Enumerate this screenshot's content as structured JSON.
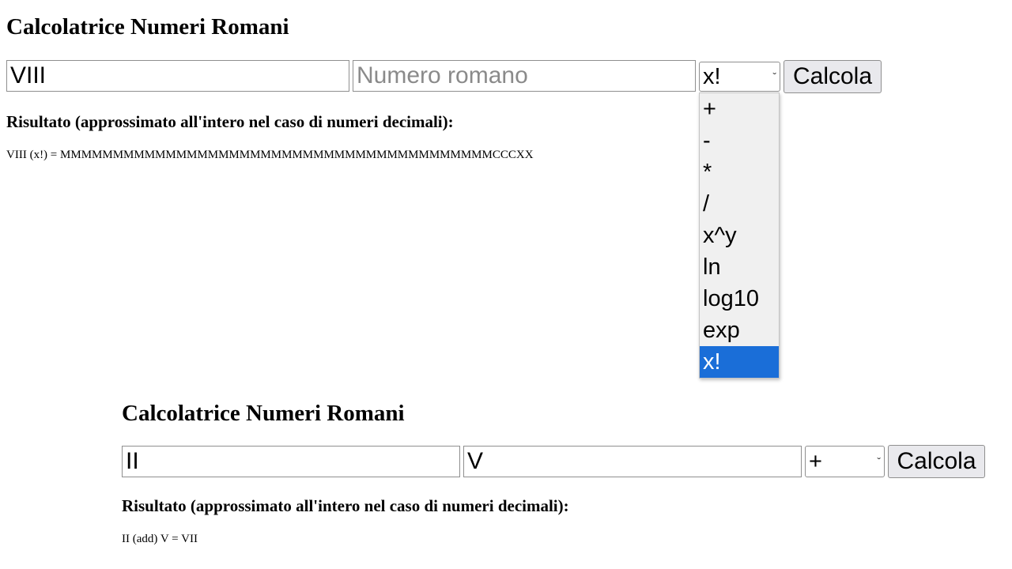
{
  "calculators": [
    {
      "title": "Calcolatrice Numeri Romani",
      "input_a": {
        "value": "VIII",
        "placeholder": "Numero romano"
      },
      "input_b": {
        "value": "",
        "placeholder": "Numero romano"
      },
      "operation": {
        "selected": "x!"
      },
      "button_label": "Calcola",
      "result_heading": "Risultato (approssimato all'intero nel caso di numeri decimali):",
      "result_text": "VIII (x!) = MMMMMMMMMMMMMMMMMMMMMMMMMMMMMMMMMMMMMMMMMCCCXX"
    },
    {
      "title": "Calcolatrice Numeri Romani",
      "input_a": {
        "value": "II",
        "placeholder": "Numero romano"
      },
      "input_b": {
        "value": "V",
        "placeholder": "Numero romano"
      },
      "operation": {
        "selected": "+"
      },
      "button_label": "Calcola",
      "result_heading": "Risultato (approssimato all'intero nel caso di numeri decimali):",
      "result_text": "II (add) V = VII"
    }
  ],
  "dropdown": {
    "options": [
      "+",
      "-",
      "*",
      "/",
      "x^y",
      "ln",
      "log10",
      "exp",
      "x!"
    ],
    "selected_index": 8,
    "highlight_color": "#1a6ed8"
  }
}
